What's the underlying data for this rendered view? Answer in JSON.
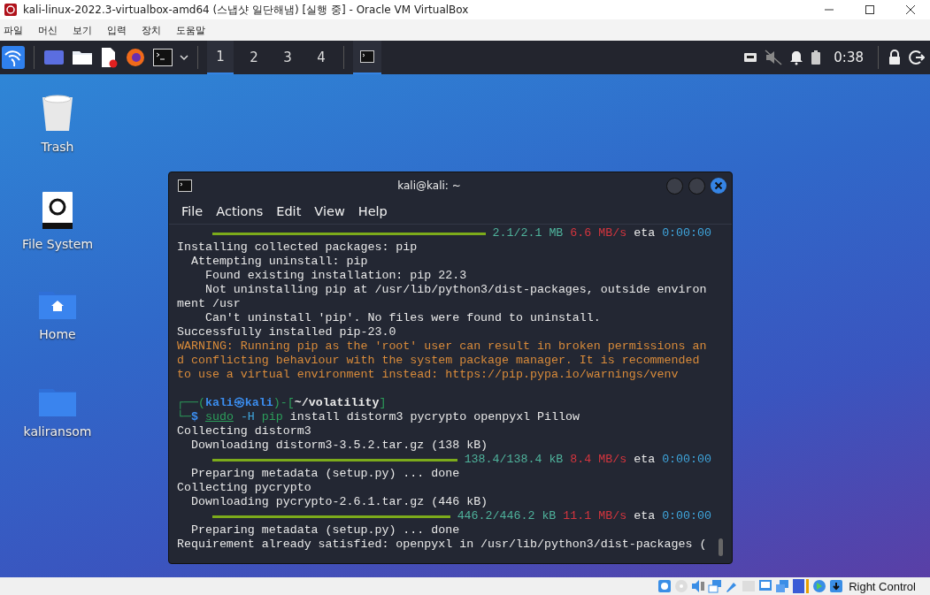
{
  "window": {
    "title": "kali-linux-2022.3-virtualbox-amd64 (스냅샷 일단해냄) [실행 중] - Oracle VM VirtualBox"
  },
  "menu": [
    "파일",
    "머신",
    "보기",
    "입력",
    "장치",
    "도움말"
  ],
  "panel": {
    "workspaces": [
      {
        "label": "1",
        "selected": true
      },
      {
        "label": "2",
        "selected": false
      },
      {
        "label": "3",
        "selected": false
      },
      {
        "label": "4",
        "selected": false
      }
    ],
    "clock": "0:38"
  },
  "desktop_icons": [
    {
      "kind": "trash",
      "label": "Trash"
    },
    {
      "kind": "drive",
      "label": "File System"
    },
    {
      "kind": "home",
      "label": "Home"
    },
    {
      "kind": "folder",
      "label": "kaliransom"
    }
  ],
  "terminal": {
    "title": "kali@kali: ~",
    "menu": [
      "File",
      "Actions",
      "Edit",
      "View",
      "Help"
    ],
    "lines": [
      {
        "kind": "progress",
        "level": 1,
        "size": "2.1/2.1 MB",
        "speed": "6.6 MB/s",
        "eta_label": "eta",
        "eta": "0:00:00"
      },
      {
        "kind": "text",
        "text": "Installing collected packages: pip"
      },
      {
        "kind": "text",
        "text": "  Attempting uninstall: pip"
      },
      {
        "kind": "text",
        "text": "    Found existing installation: pip 22.3"
      },
      {
        "kind": "text",
        "text": "    Not uninstalling pip at /usr/lib/python3/dist-packages, outside environ"
      },
      {
        "kind": "text",
        "text": "ment /usr"
      },
      {
        "kind": "text",
        "text": "    Can't uninstall 'pip'. No files were found to uninstall."
      },
      {
        "kind": "text",
        "text": "Successfully installed pip-23.0"
      },
      {
        "kind": "warning",
        "text": "WARNING: Running pip as the 'root' user can result in broken permissions an"
      },
      {
        "kind": "warning",
        "text": "d conflicting behaviour with the system package manager. It is recommended"
      },
      {
        "kind": "warning",
        "text": "to use a virtual environment instead: https://pip.pypa.io/warnings/venv"
      },
      {
        "kind": "blank"
      },
      {
        "kind": "prompt",
        "open": "┌──(",
        "user": "kali㉿kali",
        "mid": ")-[",
        "path": "~/volatility",
        "close": "]"
      },
      {
        "kind": "command",
        "corner": "└─$",
        "cmd": "sudo",
        "flag": "-H",
        "prog": "pip",
        "args": "install distorm3 pycrypto openpyxl Pillow"
      },
      {
        "kind": "text",
        "text": "Collecting distorm3"
      },
      {
        "kind": "text",
        "text": "  Downloading distorm3-3.5.2.tar.gz (138 kB)"
      },
      {
        "kind": "progress",
        "level": 1,
        "size": "138.4/138.4 kB",
        "speed": "8.4 MB/s",
        "eta_label": "eta",
        "eta": "0:00:00"
      },
      {
        "kind": "text",
        "text": "  Preparing metadata (setup.py) ... done"
      },
      {
        "kind": "text",
        "text": "Collecting pycrypto"
      },
      {
        "kind": "text",
        "text": "  Downloading pycrypto-2.6.1.tar.gz (446 kB)"
      },
      {
        "kind": "progress",
        "level": 1,
        "size": "446.2/446.2 kB",
        "speed": "11.1 MB/s",
        "eta_label": "eta",
        "eta": "0:00:00"
      },
      {
        "kind": "text",
        "text": "  Preparing metadata (setup.py) ... done"
      },
      {
        "kind": "text",
        "text": "Requirement already satisfied: openpyxl in /usr/lib/python3/dist-packages ("
      }
    ]
  },
  "status_bar": {
    "host_key": "Right Control"
  }
}
